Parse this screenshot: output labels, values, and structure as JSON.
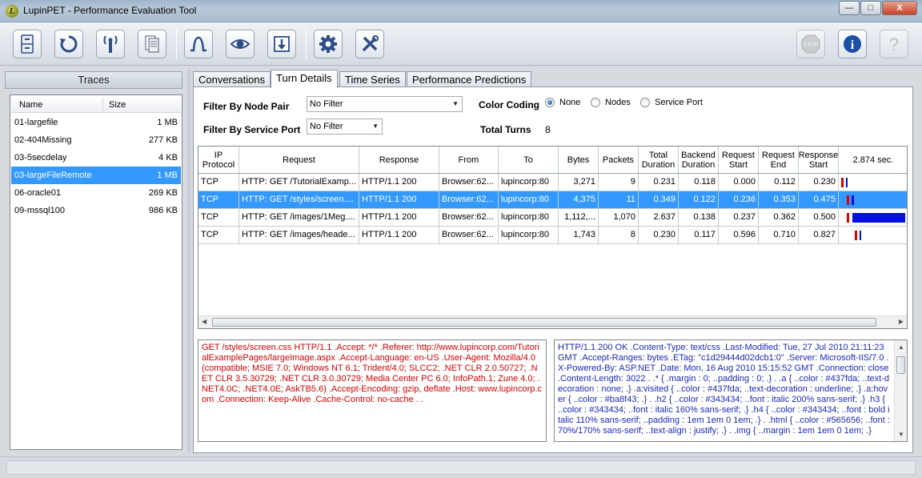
{
  "window": {
    "title": "LupinPET - Performance Evaluation Tool",
    "icon_letter": "L",
    "minimize": "—",
    "maximize": "□",
    "close": "X"
  },
  "toolbar": {
    "stop_label": "STOP",
    "info_label": "i",
    "help_label": "?"
  },
  "traces": {
    "header": "Traces",
    "col_name": "Name",
    "col_size": "Size",
    "items": [
      {
        "name": "01-largefile",
        "size": "1 MB"
      },
      {
        "name": "02-404Missing",
        "size": "277 KB"
      },
      {
        "name": "03-5secdelay",
        "size": "4 KB"
      },
      {
        "name": "03-largeFileRemote",
        "size": "1 MB"
      },
      {
        "name": "06-oracle01",
        "size": "269 KB"
      },
      {
        "name": "09-mssql100",
        "size": "986 KB"
      }
    ],
    "selected_index": 3
  },
  "tabs": [
    "Conversations",
    "Turn Details",
    "Time Series",
    "Performance Predictions"
  ],
  "active_tab": "Turn Details",
  "filters": {
    "node_pair_label": "Filter By Node Pair",
    "node_pair_value": "No Filter",
    "service_port_label": "Filter By Service Port",
    "service_port_value": "No Filter",
    "color_coding_label": "Color Coding",
    "color_options": [
      "None",
      "Nodes",
      "Service Port"
    ],
    "color_selected": "None",
    "total_turns_label": "Total Turns",
    "total_turns_value": "8"
  },
  "grid": {
    "columns": [
      "IP Protocol",
      "Request",
      "Response",
      "From",
      "To",
      "Bytes",
      "Packets",
      "Total Duration",
      "Backend Duration",
      "Request Start",
      "Request End",
      "Response Start",
      "2.874 sec."
    ],
    "rows": [
      {
        "protocol": "TCP",
        "request": "HTTP: GET /TutorialExamp...",
        "response": "HTTP/1.1 200",
        "from": "Browser:62...",
        "to": "lupincorp:80",
        "bytes": "3,271",
        "packets": "9",
        "total": "0.231",
        "backend": "0.118",
        "req_start": "0.000",
        "req_end": "0.112",
        "resp_start": "0.230",
        "bar_start": 0.0,
        "bar_req_end": 0.112,
        "bar_resp_start": 0.23,
        "bar_end": 0.231
      },
      {
        "protocol": "TCP",
        "request": "HTTP: GET /styles/screen....",
        "response": "HTTP/1.1 200",
        "from": "Browser:62...",
        "to": "lupincorp:80",
        "bytes": "4,375",
        "packets": "11",
        "total": "0.349",
        "backend": "0.122",
        "req_start": "0.236",
        "req_end": "0.353",
        "resp_start": "0.475",
        "bar_start": 0.236,
        "bar_req_end": 0.353,
        "bar_resp_start": 0.475,
        "bar_end": 0.585
      },
      {
        "protocol": "TCP",
        "request": "HTTP: GET /images/1Meg....",
        "response": "HTTP/1.1 200",
        "from": "Browser:62...",
        "to": "lupincorp:80",
        "bytes": "1,112,...",
        "packets": "1,070",
        "total": "2.637",
        "backend": "0.138",
        "req_start": "0.237",
        "req_end": "0.362",
        "resp_start": "0.500",
        "bar_start": 0.237,
        "bar_req_end": 0.362,
        "bar_resp_start": 0.5,
        "bar_end": 2.874
      },
      {
        "protocol": "TCP",
        "request": "HTTP: GET /images/heade...",
        "response": "HTTP/1.1 200",
        "from": "Browser:62...",
        "to": "lupincorp:80",
        "bytes": "1,743",
        "packets": "8",
        "total": "0.230",
        "backend": "0.117",
        "req_start": "0.596",
        "req_end": "0.710",
        "resp_start": "0.827",
        "bar_start": 0.596,
        "bar_req_end": 0.71,
        "bar_resp_start": 0.827,
        "bar_end": 0.826
      }
    ],
    "selected_index": 1,
    "timeline_total": 2.874,
    "colors": {
      "request": "#e00000",
      "response": "#0010e0"
    }
  },
  "request_text": "GET /styles/screen.css HTTP/1.1 .Accept: */* .Referer: http://www.lupincorp.com/TutorialExamplePages/largeImage.aspx .Accept-Language: en-US .User-Agent: Mozilla/4.0 (compatible; MSIE 7.0; Windows NT 6.1; Trident/4.0; SLCC2; .NET CLR 2.0.50727; .NET CLR 3.5.30729; .NET CLR 3.0.30729; Media Center PC 6.0; InfoPath.1; Zune 4.0; .NET4.0C; .NET4.0E; AskTB5.6) .Accept-Encoding: gzip, deflate .Host: www.lupincorp.com .Connection: Keep-Alive .Cache-Control: no-cache . .",
  "response_text": "HTTP/1.1 200 OK .Content-Type: text/css .Last-Modified: Tue, 27 Jul 2010 21:11:23 GMT .Accept-Ranges: bytes .ETag: \"c1d29444d02dcb1:0\" .Server: Microsoft-IIS/7.0 .X-Powered-By: ASP.NET .Date: Mon, 16 Aug 2010 15:15:52 GMT .Connection: close .Content-Length: 3022 . .* { .margin : 0; ..padding : 0; .} . .a { ..color : #437fda; ..text-decoration : none; .} .a:visited { ..color : #437fda; ..text-decoration : underline; .} .a:hover { ..color : #ba8f43; .} . .h2 { ..color : #343434; ..font : italic 200% sans-serif; .} .h3 { ..color : #343434; ..font : italic 160% sans-serif; .} .h4 { ..color : #343434; ..font : bold italic 110% sans-serif; ..padding : 1em 1em 0 1em; .} . .html { ..color : #565656; ..font : 70%/170% sans-serif; ..text-align : justify; .} . .img { ..margin : 1em 1em 0 1em; .}"
}
